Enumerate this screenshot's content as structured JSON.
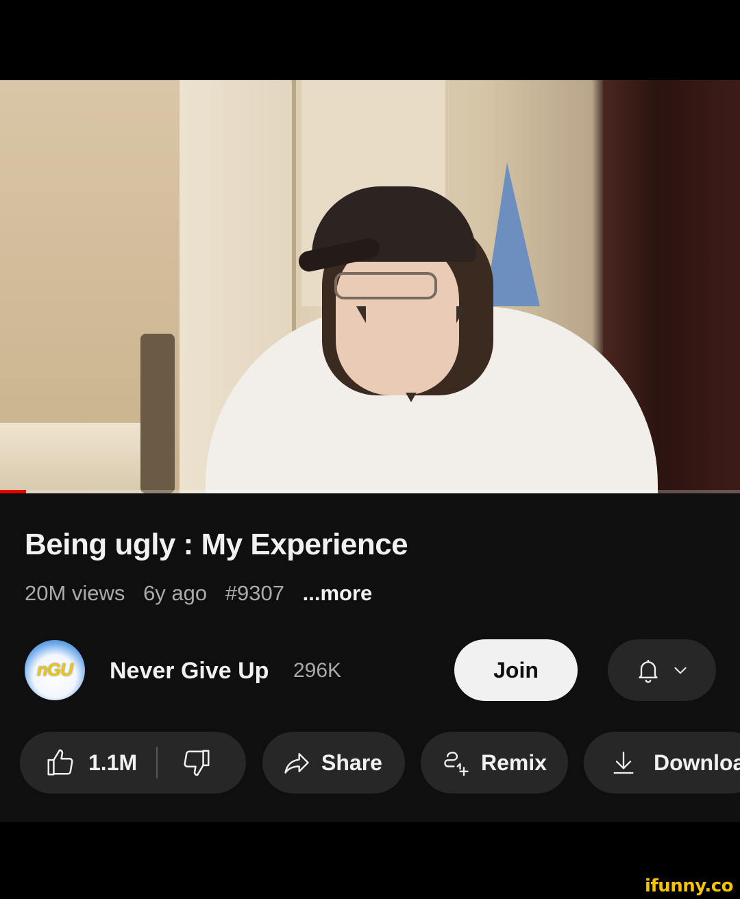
{
  "video": {
    "progress_fraction": 0.035,
    "progress_color": "#e60000"
  },
  "title": "Being ugly : My Experience",
  "meta": {
    "views": "20M views",
    "age": "6y ago",
    "hashtag": "#9307",
    "more_label": "...more"
  },
  "channel": {
    "avatar_text": "nGU",
    "name": "Never Give Up",
    "subscribers": "296K",
    "join_label": "Join",
    "bell_icon": "bell-icon",
    "chevron_icon": "chevron-down-icon"
  },
  "actions": {
    "like_count": "1.1M",
    "share_label": "Share",
    "remix_label": "Remix",
    "download_label": "Download"
  },
  "watermark": "ifunny.co",
  "colors": {
    "panel_bg": "#0f0f0f",
    "pill_bg": "#272727",
    "join_bg": "#f1f1f1",
    "secondary_text": "#aaaaaa",
    "watermark": "#f5c400"
  }
}
